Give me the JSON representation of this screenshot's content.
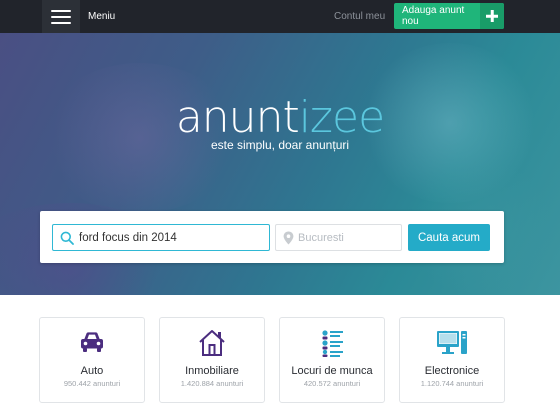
{
  "header": {
    "menu_label": "Meniu",
    "account_label": "Contul meu",
    "post_ad_label": "Adauga anunt nou"
  },
  "hero": {
    "logo_part1": "anunt",
    "logo_part2": "izee",
    "tagline": "este simplu, doar anunțuri"
  },
  "search": {
    "query_value": "ford focus din 2014",
    "location_placeholder": "Bucuresti",
    "button_label": "Cauta acum"
  },
  "categories": [
    {
      "name": "Auto",
      "count": "950.442 anunturi",
      "icon": "car-icon"
    },
    {
      "name": "Inmobiliare",
      "count": "1.420.884 anunturi",
      "icon": "house-icon"
    },
    {
      "name": "Locuri de munca",
      "count": "420.572 anunturi",
      "icon": "job-list-icon"
    },
    {
      "name": "Electronice",
      "count": "1.120.744 anunturi",
      "icon": "computer-icon"
    }
  ],
  "colors": {
    "topbar": "#21242b",
    "accent_green": "#1fb57a",
    "accent_blue": "#24abc8",
    "logo_accent": "#5bc7de",
    "category_purple": "#4b2d7f",
    "category_blue": "#2aa3c9"
  }
}
